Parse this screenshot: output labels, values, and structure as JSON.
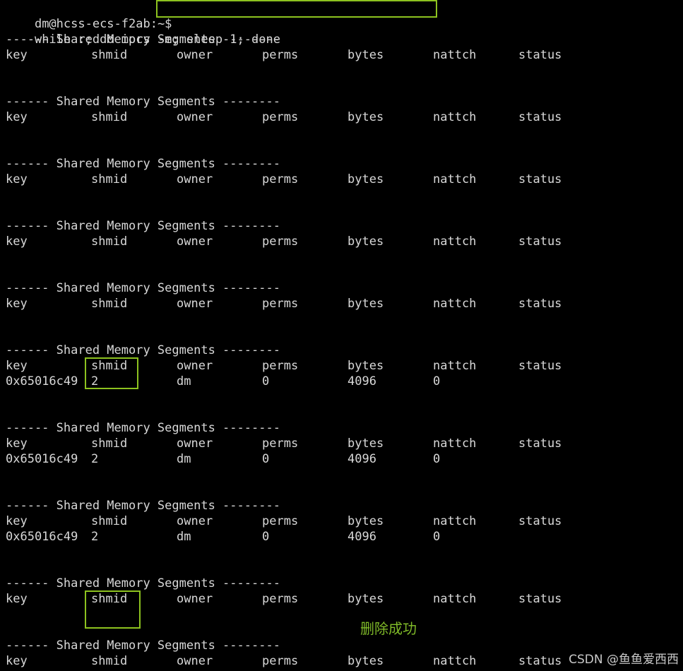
{
  "prompt": {
    "user_host": "dm@hcss-ecs-f2ab:~$",
    "command": "while :; do ipcs -m; sleep 1; done"
  },
  "section_title": "------ Shared Memory Segments --------",
  "columns": [
    "key",
    "shmid",
    "owner",
    "perms",
    "bytes",
    "nattch",
    "status"
  ],
  "blocks": [
    {
      "rows": []
    },
    {
      "rows": []
    },
    {
      "rows": []
    },
    {
      "rows": []
    },
    {
      "rows": []
    },
    {
      "rows": [
        [
          "0x65016c49",
          "2",
          "dm",
          "0",
          "4096",
          "0",
          ""
        ]
      ]
    },
    {
      "rows": [
        [
          "0x65016c49",
          "2",
          "dm",
          "0",
          "4096",
          "0",
          ""
        ]
      ]
    },
    {
      "rows": [
        [
          "0x65016c49",
          "2",
          "dm",
          "0",
          "4096",
          "0",
          ""
        ]
      ]
    },
    {
      "rows": []
    },
    {
      "rows": []
    }
  ],
  "annotation": "删除成功",
  "watermark": "CSDN @鱼鱼爱西西",
  "colors": {
    "highlight": "#8dc21f",
    "annotation": "#7fb928"
  }
}
